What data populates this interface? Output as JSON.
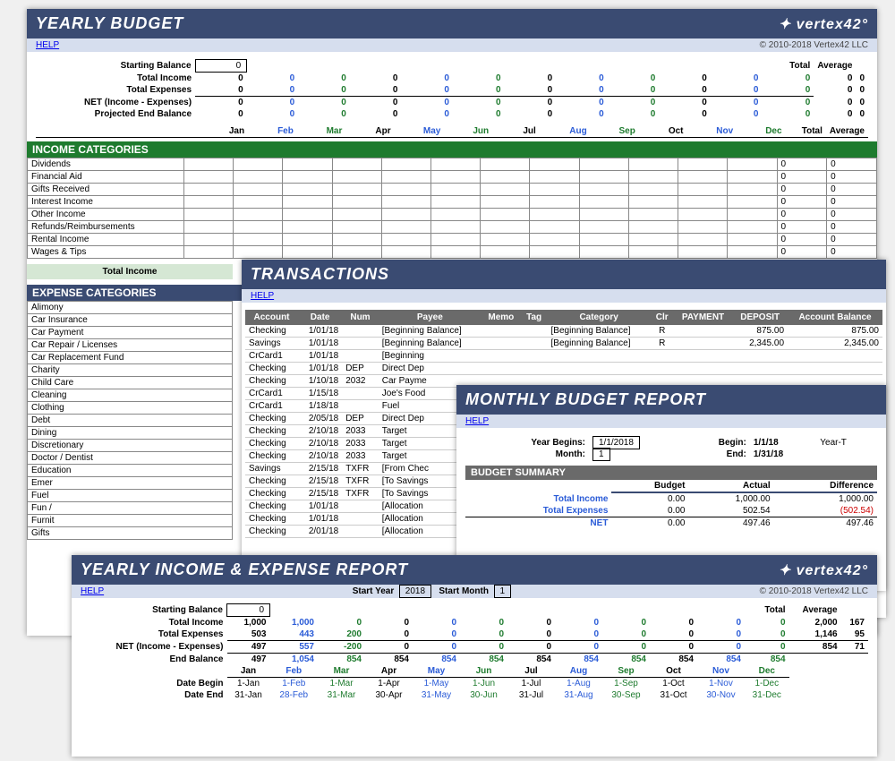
{
  "copy": "© 2010-2018 Vertex42 LLC",
  "help": "HELP",
  "months": [
    "Jan",
    "Feb",
    "Mar",
    "Apr",
    "May",
    "Jun",
    "Jul",
    "Aug",
    "Sep",
    "Oct",
    "Nov",
    "Dec"
  ],
  "yearly": {
    "title": "YEARLY BUDGET",
    "rows": [
      "Starting Balance",
      "Total Income",
      "Total Expenses",
      "NET (Income - Expenses)",
      "Projected End Balance"
    ],
    "startBal": "0",
    "zero": "0",
    "income_title": "INCOME CATEGORIES",
    "income_cats": [
      "Dividends",
      "Financial Aid",
      "Gifts Received",
      "Interest Income",
      "Other Income",
      "Refunds/Reimbursements",
      "Rental Income",
      "Wages & Tips"
    ],
    "total_income": "Total Income",
    "expense_title": "EXPENSE CATEGORIES",
    "expense_cats": [
      "Alimony",
      "Car Insurance",
      "Car Payment",
      "Car Repair / Licenses",
      "Car Replacement Fund",
      "Charity",
      "Child Care",
      "Cleaning",
      "Clothing",
      "Debt",
      "Dining",
      "Discretionary",
      "Doctor / Dentist",
      "Education",
      "Emer",
      "Fuel",
      "Fun /",
      "Furnit",
      "Gifts"
    ],
    "total_avg": [
      "Total",
      "Average"
    ]
  },
  "trans": {
    "title": "TRANSACTIONS",
    "cols": [
      "Account",
      "Date",
      "Num",
      "Payee",
      "Memo",
      "Tag",
      "Category",
      "Clr",
      "PAYMENT",
      "DEPOSIT",
      "Account Balance"
    ],
    "rows": [
      {
        "a": "Checking",
        "d": "1/01/18",
        "n": "",
        "p": "[Beginning Balance]",
        "c": "[Beginning Balance]",
        "r": "R",
        "pay": "",
        "dep": "875.00",
        "bal": "875.00"
      },
      {
        "a": "Savings",
        "d": "1/01/18",
        "n": "",
        "p": "[Beginning Balance]",
        "c": "[Beginning Balance]",
        "r": "R",
        "pay": "",
        "dep": "2,345.00",
        "bal": "2,345.00"
      },
      {
        "a": "CrCard1",
        "d": "1/01/18",
        "n": "",
        "p": "[Beginning",
        "c": "",
        "r": "",
        "pay": "",
        "dep": "",
        "bal": ""
      },
      {
        "a": "Checking",
        "d": "1/01/18",
        "n": "DEP",
        "p": "Direct Dep",
        "c": "",
        "r": "",
        "pay": "",
        "dep": "",
        "bal": ""
      },
      {
        "a": "Checking",
        "d": "1/10/18",
        "n": "2032",
        "p": "Car Payme",
        "c": "",
        "r": "",
        "pay": "",
        "dep": "",
        "bal": ""
      },
      {
        "a": "CrCard1",
        "d": "1/15/18",
        "n": "",
        "p": "Joe's Food",
        "c": "",
        "r": "",
        "pay": "",
        "dep": "",
        "bal": ""
      },
      {
        "a": "CrCard1",
        "d": "1/18/18",
        "n": "",
        "p": "Fuel",
        "c": "",
        "r": "",
        "pay": "",
        "dep": "",
        "bal": ""
      },
      {
        "a": "Checking",
        "d": "2/05/18",
        "n": "DEP",
        "p": "Direct Dep",
        "c": "",
        "r": "",
        "pay": "",
        "dep": "",
        "bal": ""
      },
      {
        "a": "Checking",
        "d": "2/10/18",
        "n": "2033",
        "p": "Target",
        "c": "",
        "r": "",
        "pay": "",
        "dep": "",
        "bal": ""
      },
      {
        "a": "Checking",
        "d": "2/10/18",
        "n": "2033",
        "p": "Target",
        "c": "",
        "r": "",
        "pay": "",
        "dep": "",
        "bal": ""
      },
      {
        "a": "Checking",
        "d": "2/10/18",
        "n": "2033",
        "p": "Target",
        "c": "",
        "r": "",
        "pay": "",
        "dep": "",
        "bal": ""
      },
      {
        "a": "Savings",
        "d": "2/15/18",
        "n": "TXFR",
        "p": "[From Chec",
        "c": "",
        "r": "",
        "pay": "",
        "dep": "",
        "bal": ""
      },
      {
        "a": "Checking",
        "d": "2/15/18",
        "n": "TXFR",
        "p": "[To Savings",
        "c": "",
        "r": "",
        "pay": "",
        "dep": "",
        "bal": ""
      },
      {
        "a": "Checking",
        "d": "2/15/18",
        "n": "TXFR",
        "p": "[To Savings",
        "c": "",
        "r": "",
        "pay": "",
        "dep": "",
        "bal": ""
      },
      {
        "a": "Checking",
        "d": "1/01/18",
        "n": "",
        "p": "[Allocation",
        "c": "",
        "r": "",
        "pay": "",
        "dep": "",
        "bal": ""
      },
      {
        "a": "Checking",
        "d": "1/01/18",
        "n": "",
        "p": "[Allocation",
        "c": "",
        "r": "",
        "pay": "",
        "dep": "",
        "bal": ""
      },
      {
        "a": "Checking",
        "d": "2/01/18",
        "n": "",
        "p": "[Allocation",
        "c": "",
        "r": "",
        "pay": "",
        "dep": "",
        "bal": ""
      }
    ]
  },
  "monthly": {
    "title": "MONTHLY BUDGET REPORT",
    "yb": "Year Begins:",
    "yb_v": "1/1/2018",
    "m": "Month:",
    "m_v": "1",
    "begin": "Begin:",
    "begin_v": "1/1/18",
    "end": "End:",
    "end_v": "1/31/18",
    "yt": "Year-T",
    "summary": "BUDGET SUMMARY",
    "cols": [
      "Budget",
      "Actual",
      "Difference"
    ],
    "rows": [
      {
        "l": "Total Income",
        "b": "0.00",
        "a": "1,000.00",
        "d": "1,000.00"
      },
      {
        "l": "Total Expenses",
        "b": "0.00",
        "a": "502.54",
        "d": "(502.54)",
        "red": true
      },
      {
        "l": "NET",
        "b": "0.00",
        "a": "497.46",
        "d": "497.46"
      }
    ]
  },
  "ie": {
    "title": "YEARLY INCOME & EXPENSE REPORT",
    "sy": "Start Year",
    "sy_v": "2018",
    "sm": "Start Month",
    "sm_v": "1",
    "rows": {
      "sb": {
        "l": "Starting Balance",
        "v": "0"
      },
      "ti": {
        "l": "Total Income",
        "d": [
          "1,000",
          "1,000",
          "0",
          "0",
          "0",
          "0",
          "0",
          "0",
          "0",
          "0",
          "0",
          "0"
        ],
        "t": "2,000",
        "a": "167"
      },
      "te": {
        "l": "Total Expenses",
        "d": [
          "503",
          "443",
          "200",
          "0",
          "0",
          "0",
          "0",
          "0",
          "0",
          "0",
          "0",
          "0"
        ],
        "t": "1,146",
        "a": "95"
      },
      "net": {
        "l": "NET (Income - Expenses)",
        "d": [
          "497",
          "557",
          "-200",
          "0",
          "0",
          "0",
          "0",
          "0",
          "0",
          "0",
          "0",
          "0"
        ],
        "t": "854",
        "a": "71"
      },
      "eb": {
        "l": "End Balance",
        "d": [
          "497",
          "1,054",
          "854",
          "854",
          "854",
          "854",
          "854",
          "854",
          "854",
          "854",
          "854",
          "854"
        ]
      }
    },
    "db": "Date Begin",
    "db_v": [
      "1-Jan",
      "1-Feb",
      "1-Mar",
      "1-Apr",
      "1-May",
      "1-Jun",
      "1-Jul",
      "1-Aug",
      "1-Sep",
      "1-Oct",
      "1-Nov",
      "1-Dec"
    ],
    "de": "Date End",
    "de_v": [
      "31-Jan",
      "28-Feb",
      "31-Mar",
      "30-Apr",
      "31-May",
      "30-Jun",
      "31-Jul",
      "31-Aug",
      "30-Sep",
      "31-Oct",
      "30-Nov",
      "31-Dec"
    ]
  }
}
